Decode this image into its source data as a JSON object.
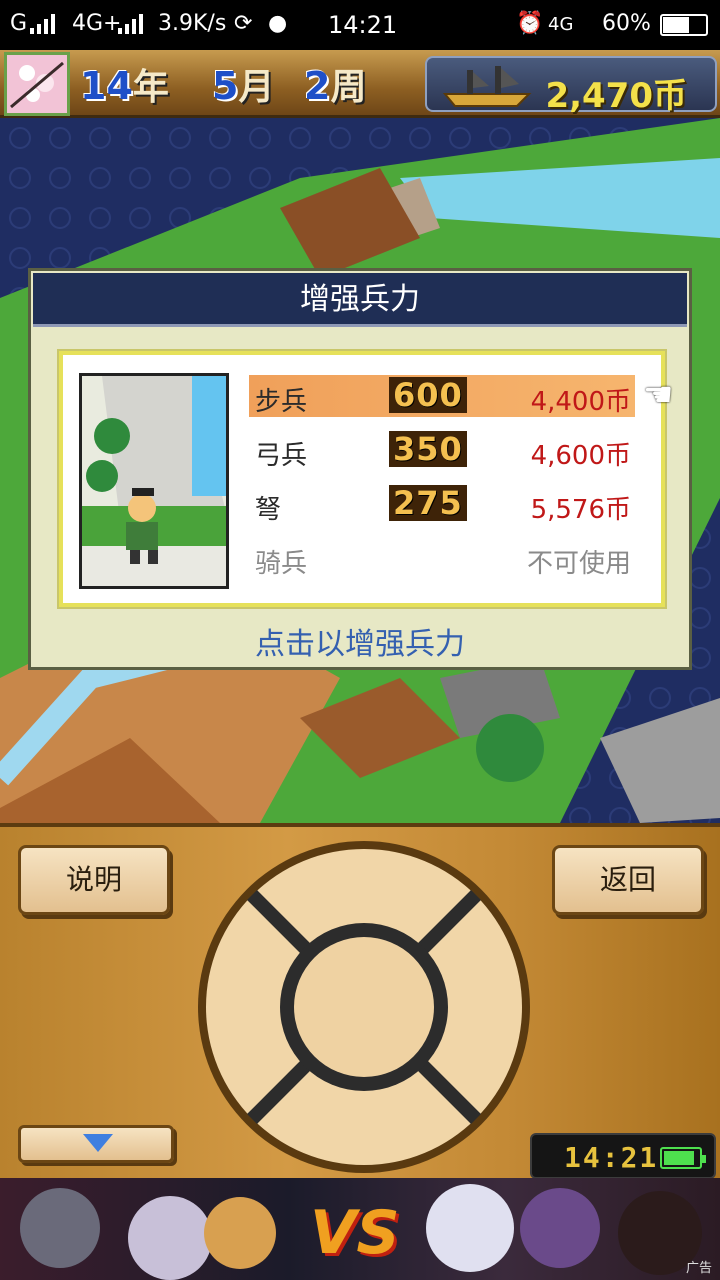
{
  "status_bar": {
    "carrier": "G",
    "network": "4G+",
    "speed": "3.9K/s",
    "time": "14:21",
    "network2": "4G",
    "battery": "60%"
  },
  "top_bar": {
    "year_num": "14",
    "year_unit": "年",
    "month_num": "5",
    "month_unit": "月",
    "week_num": "2",
    "week_unit": "周",
    "money": "2,470币"
  },
  "dialog": {
    "title": "增强兵力",
    "units": [
      {
        "name": "步兵",
        "count": "600",
        "price": "4,400币",
        "selected": true
      },
      {
        "name": "弓兵",
        "count": "350",
        "price": "4,600币"
      },
      {
        "name": "弩",
        "count": "275",
        "price": "5,576币"
      },
      {
        "name": "骑兵",
        "count": "",
        "price": "不可使用",
        "disabled": true
      }
    ],
    "hint": "点击以增强兵力"
  },
  "controller": {
    "help_label": "说明",
    "back_label": "返回",
    "clock": "14:21"
  },
  "ad": {
    "label": "广告",
    "vs": "VS"
  },
  "colors": {
    "dialog_title_bg": "#1f2e55",
    "selected_row": "#f0a05a",
    "price_red": "#c01818",
    "hint_blue": "#3460b0",
    "money_yellow": "#f4e14a"
  }
}
